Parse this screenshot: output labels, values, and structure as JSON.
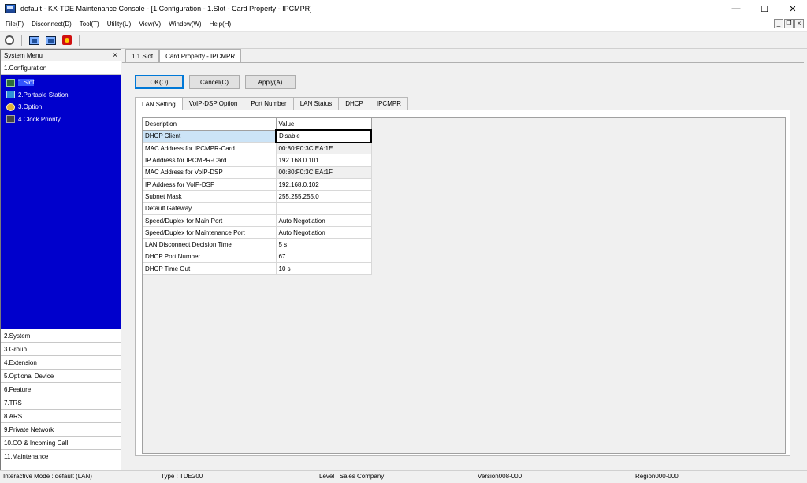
{
  "window": {
    "title": "default - KX-TDE Maintenance Console - [1.Configuration - 1.Slot - Card Property - IPCMPR]",
    "minimize": "—",
    "maximize": "☐",
    "close": "✕"
  },
  "menu": [
    "File(F)",
    "Disconnect(D)",
    "Tool(T)",
    "Utility(U)",
    "View(V)",
    "Window(W)",
    "Help(H)"
  ],
  "mdi": {
    "minimize": "_",
    "restore": "❐",
    "close": "x"
  },
  "toolbar": {
    "icons": [
      "disconnect-icon",
      "pc-monitor-icon",
      "network-monitor-icon",
      "security-key-icon"
    ]
  },
  "left_panel": {
    "header": "System Menu",
    "close": "×",
    "active_category": "1.Configuration",
    "tree": [
      {
        "label": "1.Slot",
        "icon": "slot-icon"
      },
      {
        "label": "2.Portable Station",
        "icon": "portable-station-icon"
      },
      {
        "label": "3.Option",
        "icon": "option-icon"
      },
      {
        "label": "4.Clock Priority",
        "icon": "clock-priority-icon"
      }
    ],
    "categories": [
      "2.System",
      "3.Group",
      "4.Extension",
      "5.Optional Device",
      "6.Feature",
      "7.TRS",
      "8.ARS",
      "9.Private Network",
      "10.CO & Incoming Call",
      "11.Maintenance"
    ]
  },
  "doc_tabs": [
    "1.1 Slot",
    "Card Property - IPCMPR"
  ],
  "buttons": {
    "ok": "OK(O)",
    "cancel": "Cancel(C)",
    "apply": "Apply(A)"
  },
  "prop_tabs": [
    "LAN Setting",
    "VoIP-DSP Option",
    "Port Number",
    "LAN Status",
    "DHCP",
    "IPCMPR"
  ],
  "grid": {
    "headers": {
      "description": "Description",
      "value": "Value"
    },
    "rows": [
      {
        "description": "DHCP Client",
        "value": "Disable"
      },
      {
        "description": "MAC Address for IPCMPR-Card",
        "value": "00:80:F0:3C:EA:1E"
      },
      {
        "description": "IP Address for IPCMPR-Card",
        "value": "192.168.0.101"
      },
      {
        "description": "MAC Address for VoIP-DSP",
        "value": "00:80:F0:3C:EA:1F"
      },
      {
        "description": "IP Address for VoIP-DSP",
        "value": "192.168.0.102"
      },
      {
        "description": "Subnet Mask",
        "value": "255.255.255.0"
      },
      {
        "description": "Default Gateway",
        "value": ""
      },
      {
        "description": "Speed/Duplex for Main Port",
        "value": "Auto Negotiation"
      },
      {
        "description": "Speed/Duplex for Maintenance Port",
        "value": "Auto Negotiation"
      },
      {
        "description": "LAN Disconnect Decision Time",
        "value": "5 s"
      },
      {
        "description": "DHCP Port Number",
        "value": "67"
      },
      {
        "description": "DHCP Time Out",
        "value": "10 s"
      }
    ]
  },
  "status": {
    "mode": "Interactive Mode : default (LAN)",
    "type": "Type : TDE200",
    "level": "Level : Sales Company",
    "version": "Version008-000",
    "region": "Region000-000"
  },
  "colors": {
    "tree_bg": "#0000cc",
    "selection": "#cce4f7",
    "default_button_border": "#0078d7"
  }
}
